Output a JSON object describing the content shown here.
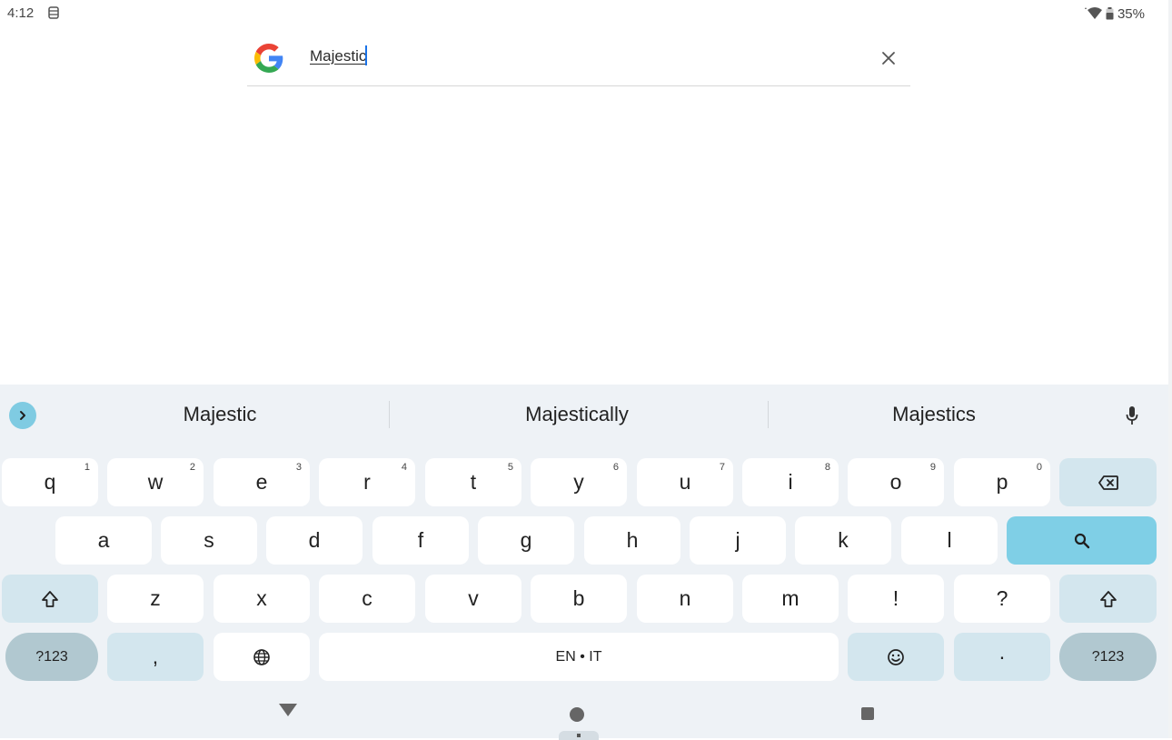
{
  "status_bar": {
    "time": "4:12",
    "battery": "35%"
  },
  "search": {
    "query": "Majestic"
  },
  "keyboard": {
    "suggestions": [
      "Majestic",
      "Majestically",
      "Majestics"
    ],
    "rows": {
      "row1": [
        {
          "label": "q",
          "hint": "1"
        },
        {
          "label": "w",
          "hint": "2"
        },
        {
          "label": "e",
          "hint": "3"
        },
        {
          "label": "r",
          "hint": "4"
        },
        {
          "label": "t",
          "hint": "5"
        },
        {
          "label": "y",
          "hint": "6"
        },
        {
          "label": "u",
          "hint": "7"
        },
        {
          "label": "i",
          "hint": "8"
        },
        {
          "label": "o",
          "hint": "9"
        },
        {
          "label": "p",
          "hint": "0"
        }
      ],
      "row2": [
        "a",
        "s",
        "d",
        "f",
        "g",
        "h",
        "j",
        "k",
        "l"
      ],
      "row3": [
        "z",
        "x",
        "c",
        "v",
        "b",
        "n",
        "m",
        "!",
        "?"
      ]
    },
    "symbols_label": "?123",
    "comma": ",",
    "space_label": "EN • IT",
    "period": "·"
  },
  "colors": {
    "accent_key": "#7fcfe6",
    "modifier_key": "#d3e6ee",
    "keyboard_bg": "#eef2f6",
    "caret": "#1a73e8"
  },
  "icons": {
    "google": "google-g-icon",
    "clear": "close-icon",
    "expand": "chevron-right-icon",
    "mic": "microphone-icon",
    "backspace": "backspace-icon",
    "search": "search-icon",
    "shift": "shift-icon",
    "globe": "globe-icon",
    "emoji": "emoji-icon"
  }
}
